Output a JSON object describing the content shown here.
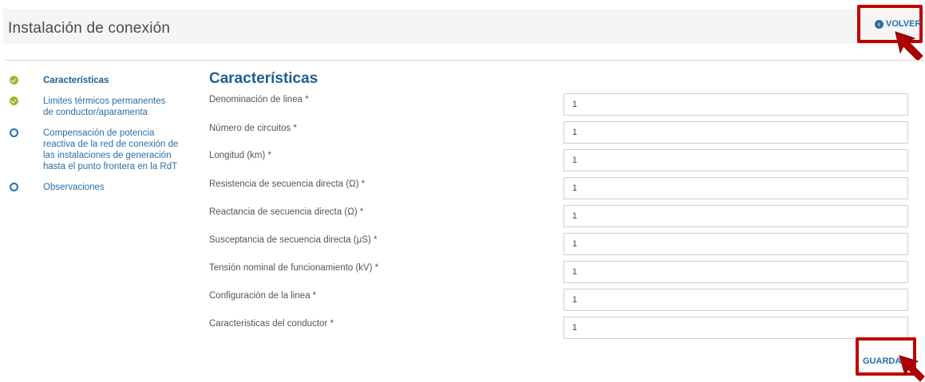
{
  "header": {
    "title": "Instalación de conexión",
    "back_label": "VOLVER",
    "back_icon": "arrow-left-circle-icon"
  },
  "sidebar": {
    "steps": [
      {
        "label": "Características",
        "status": "done",
        "active": true
      },
      {
        "label": "Limites térmicos permanentes de conductor/aparamenta",
        "status": "done",
        "active": false
      },
      {
        "label": "Compensación de potencia reactiva de la red de conexión de las instalaciones de generación hasta el punto frontera en la RdT",
        "status": "pending",
        "active": false
      },
      {
        "label": "Observaciones",
        "status": "pending",
        "active": false
      }
    ]
  },
  "form": {
    "title": "Características",
    "fields": [
      {
        "label": "Denominación de linea *",
        "value": "1"
      },
      {
        "label": "Número de circuitos *",
        "value": "1"
      },
      {
        "label": "Longitud (km) *",
        "value": "1"
      },
      {
        "label": "Resistencia de secuencia directa (Ω) *",
        "value": "1"
      },
      {
        "label": "Reactancia de secuencia directa (Ω) *",
        "value": "1"
      },
      {
        "label": "Susceptancia de secuencia directa (μS) *",
        "value": "1"
      },
      {
        "label": "Tensión nominal de funcionamiento (kV) *",
        "value": "1"
      },
      {
        "label": "Configuración de la linea *",
        "value": "1"
      },
      {
        "label": "Caracteristicas del conductor *",
        "value": "1"
      }
    ],
    "save_label": "GUARDAR"
  },
  "colors": {
    "accent": "#2a6ea6",
    "title_blue": "#1e5f94",
    "done_green": "#a5b32e",
    "highlight_red": "#c00000"
  }
}
